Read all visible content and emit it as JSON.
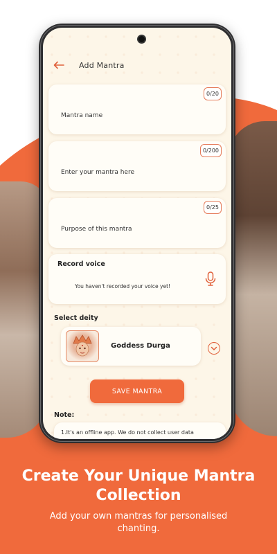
{
  "header": {
    "title": "Add Mantra",
    "back_icon": "arrow-left-icon"
  },
  "fields": [
    {
      "label": "Mantra name",
      "counter": "0/20"
    },
    {
      "label": "Enter your mantra here",
      "counter": "0/200"
    },
    {
      "label": "Purpose of this mantra",
      "counter": "0/25"
    }
  ],
  "record": {
    "title": "Record voice",
    "message": "You haven't recorded your voice yet!",
    "icon": "microphone-icon"
  },
  "deity": {
    "section_label": "Select deity",
    "name": "Goddess Durga",
    "dropdown_icon": "chevron-down-icon"
  },
  "save_label": "SAVE MANTRA",
  "note": {
    "label": "Note:",
    "text": "1.It's an offline app. We do not collect user data"
  },
  "promo": {
    "headline_line1": "Create Your Unique Mantra",
    "headline_line2": "Collection",
    "subline_line1": "Add your own mantras for personalised",
    "subline_line2": "chanting."
  },
  "colors": {
    "accent": "#f06a3c",
    "screen_bg": "#fdf6e8"
  }
}
